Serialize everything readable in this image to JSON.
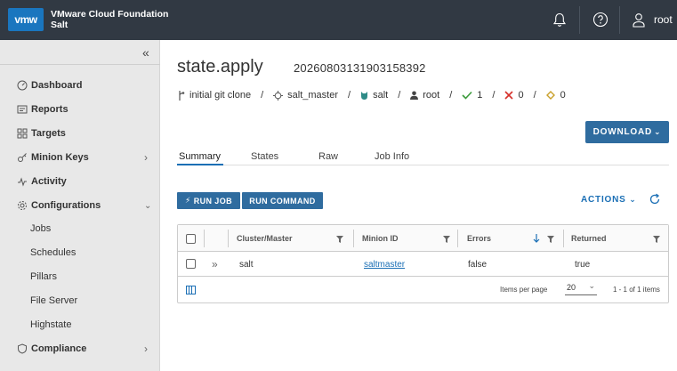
{
  "header": {
    "logo": "vmw",
    "product": "VMware Cloud Foundation",
    "app": "Salt",
    "user": "root",
    "icons": [
      "bell-icon",
      "help-icon",
      "user-icon"
    ]
  },
  "sidebar": {
    "items": [
      {
        "label": "Dashboard",
        "icon": "dashboard-icon"
      },
      {
        "label": "Reports",
        "icon": "reports-icon"
      },
      {
        "label": "Targets",
        "icon": "targets-icon"
      },
      {
        "label": "Minion Keys",
        "icon": "key-icon"
      },
      {
        "label": "Activity",
        "icon": "activity-icon"
      },
      {
        "label": "Configurations",
        "icon": "gear-icon"
      },
      {
        "label": "Compliance",
        "icon": "shield-icon"
      }
    ],
    "sub_items": [
      "Jobs",
      "Schedules",
      "Pillars",
      "File Server",
      "Highstate"
    ]
  },
  "job": {
    "title": "state.apply",
    "jid": "20260803131903158392",
    "meta": {
      "commit": "initial git clone",
      "master": "salt_master",
      "minion": "salt",
      "user": "root",
      "succeeded": "1",
      "failed": "0",
      "changed": "0"
    }
  },
  "buttons": {
    "download": "DOWNLOAD",
    "run_job": "RUN JOB",
    "run_command": "RUN COMMAND",
    "actions": "ACTIONS"
  },
  "tabs": [
    "Summary",
    "States",
    "Raw",
    "Job Info"
  ],
  "grid": {
    "columns": [
      "Cluster/Master",
      "Minion ID",
      "Errors",
      "Returned"
    ],
    "rows": [
      {
        "cluster": "salt",
        "minion": "saltmaster",
        "errors": "false",
        "returned": "true"
      }
    ],
    "footer": {
      "items_per_page_label": "Items per page",
      "items_per_page": "20",
      "range": "1 - 1 of 1 items"
    }
  },
  "colors": {
    "header_bg": "#313943",
    "accent": "#2f6c9f",
    "link": "#1b6fb5",
    "success": "#3c9b3c",
    "error": "#d6312b",
    "warning": "#c9a02b"
  }
}
